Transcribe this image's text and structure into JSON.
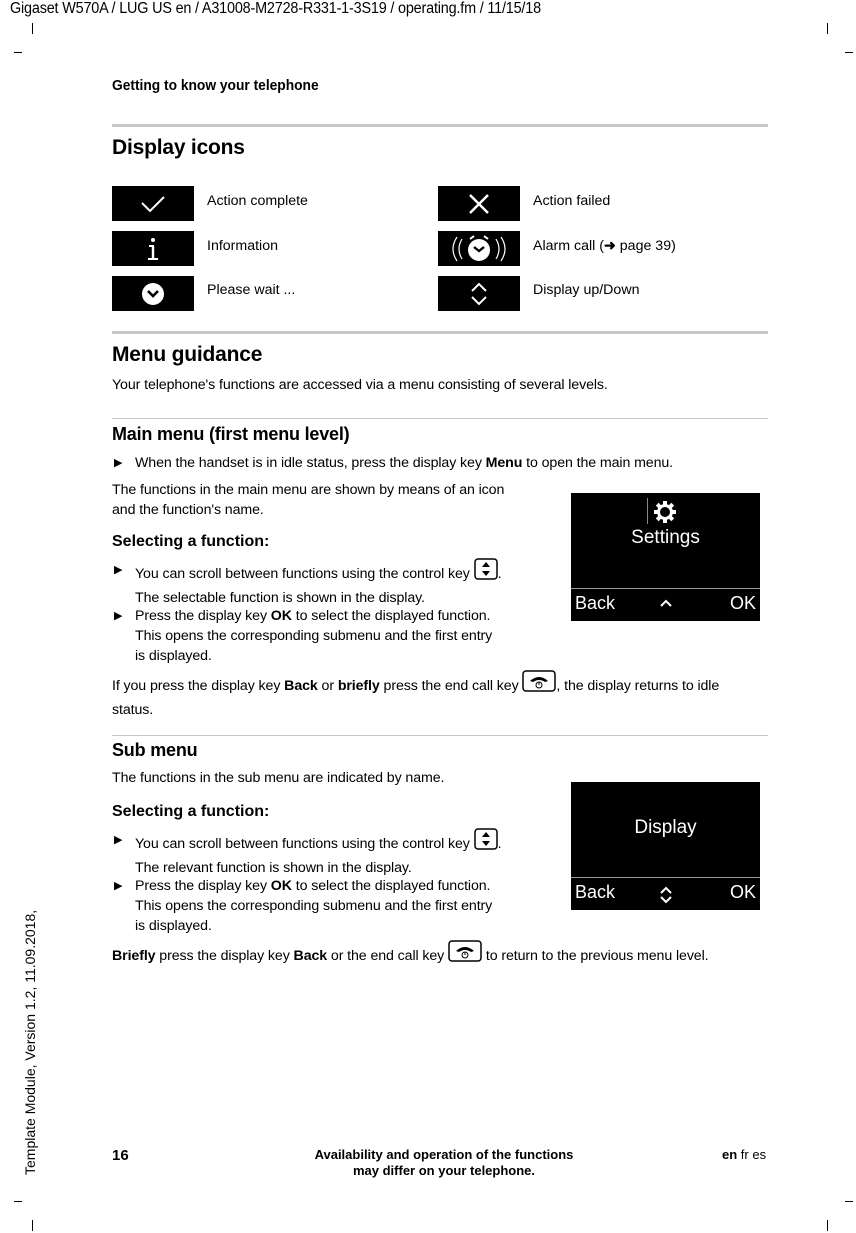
{
  "header": {
    "doc_info": "Gigaset W570A / LUG US en / A31008-M2728-R331-1-3S19 / operating.fm / 11/15/18",
    "section": "Getting to know your telephone"
  },
  "display_icons": {
    "title": "Display icons",
    "items": [
      {
        "icon": "checkmark-icon",
        "label": "Action complete"
      },
      {
        "icon": "cross-icon",
        "label": "Action failed"
      },
      {
        "icon": "info-icon",
        "label": "Information"
      },
      {
        "icon": "alarm-clock-icon",
        "label": "Alarm call (",
        "link_arrow": "arrow-right-icon",
        "link_text": "page 39",
        "label_end": ")"
      },
      {
        "icon": "clock-icon",
        "label": "Please wait ..."
      },
      {
        "icon": "up-down-chevron-icon",
        "label": "Display up/Down"
      }
    ]
  },
  "menu_guidance": {
    "title": "Menu guidance",
    "intro": "Your telephone's functions are accessed via a menu consisting of several levels."
  },
  "main_menu": {
    "title": "Main menu (first menu level)",
    "step1_pre": "When the handset is in idle status, press the display key ",
    "step1_bold": "Menu",
    "step1_post": " to open the main menu.",
    "desc_line1": "The functions in the main menu are shown by means of an icon",
    "desc_line2": "and the function's name.",
    "selecting_title": "Selecting a function:",
    "bullet1_line1": "You can scroll between functions using the control key",
    "bullet1_line2": "The selectable function is shown in the display.",
    "bullet2_pre": "Press the display key ",
    "bullet2_bold": "OK",
    "bullet2_post": " to select the displayed function.",
    "bullet2_line2": "This opens the corresponding submenu and the first entry",
    "bullet2_line3": "is displayed.",
    "return_pre": "If you press the display key ",
    "return_bold1": "Back",
    "return_mid": " or ",
    "return_bold2": "briefly",
    "return_mid2": " press the end call key ",
    "return_post": ", the display returns to idle",
    "return_line2": "status.",
    "screen": {
      "icon": "gear-icon",
      "title": "Settings",
      "left_key": "Back",
      "center_icon": "chevron-up-icon",
      "right_key": "OK"
    }
  },
  "sub_menu": {
    "title": "Sub menu",
    "desc": "The functions in the sub menu are indicated by name.",
    "selecting_title": "Selecting a function:",
    "bullet1_line1": "You can scroll between functions using the control key",
    "bullet1_line2": "The relevant function is shown in the display.",
    "bullet2_pre": "Press the display key ",
    "bullet2_bold": "OK",
    "bullet2_post": " to select the displayed function.",
    "bullet2_line2": "This opens the corresponding submenu and the first entry",
    "bullet2_line3": "is displayed.",
    "return_bold1": "Briefly",
    "return_mid": " press the display key ",
    "return_bold2": "Back",
    "return_mid2": " or the end call key ",
    "return_post": " to return to the previous menu level.",
    "screen": {
      "title": "Display",
      "left_key": "Back",
      "center_icon": "up-down-chevron-icon",
      "right_key": "OK"
    }
  },
  "footer": {
    "page_number": "16",
    "note_line1": "Availability and operation of the functions",
    "note_line2": "may differ on your telephone.",
    "lang_bold": "en",
    "lang_rest": " fr es"
  },
  "side_note": "Template Module, Version 1.2, 11.09.2018,"
}
